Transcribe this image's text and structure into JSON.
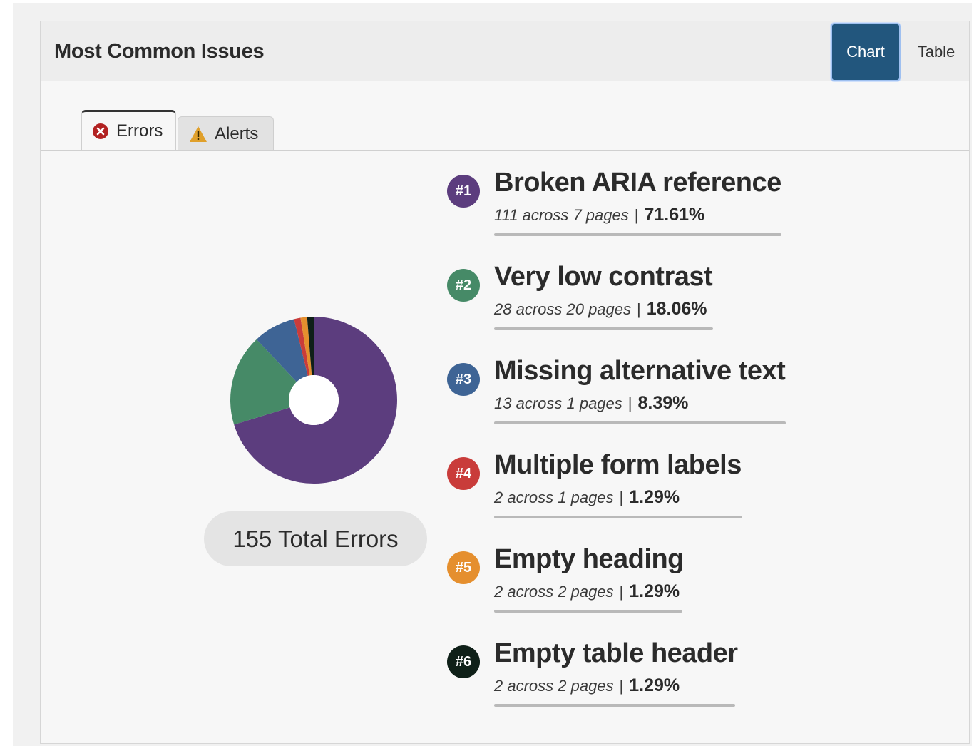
{
  "header": {
    "title": "Most Common Issues",
    "chart_button": "Chart",
    "table_button": "Table"
  },
  "tabs": [
    {
      "label": "Errors",
      "icon": "error-circle-icon",
      "active": true
    },
    {
      "label": "Alerts",
      "icon": "warning-triangle-icon",
      "active": false
    }
  ],
  "total_label": "155 Total Errors",
  "issues": [
    {
      "rank": "#1",
      "name": "Broken ARIA reference",
      "count_text": "111 across 7 pages",
      "percent": "71.61%",
      "color": "#5c3d7e"
    },
    {
      "rank": "#2",
      "name": "Very low contrast",
      "count_text": "28 across 20 pages",
      "percent": "18.06%",
      "color": "#468a67"
    },
    {
      "rank": "#3",
      "name": "Missing alternative text",
      "count_text": "13 across 1 pages",
      "percent": "8.39%",
      "color": "#3e6495"
    },
    {
      "rank": "#4",
      "name": "Multiple form labels",
      "count_text": "2 across 1 pages",
      "percent": "1.29%",
      "color": "#c93c3a"
    },
    {
      "rank": "#5",
      "name": "Empty heading",
      "count_text": "2 across 2 pages",
      "percent": "1.29%",
      "color": "#e58f2e"
    },
    {
      "rank": "#6",
      "name": "Empty table header",
      "count_text": "2 across 2 pages",
      "percent": "1.29%",
      "color": "#0f2018"
    }
  ],
  "chart_data": {
    "type": "pie",
    "categories": [
      "Broken ARIA reference",
      "Very low contrast",
      "Missing alternative text",
      "Multiple form labels",
      "Empty heading",
      "Empty table header"
    ],
    "values": [
      111,
      28,
      13,
      2,
      2,
      2
    ],
    "colors": [
      "#5c3d7e",
      "#468a67",
      "#3e6495",
      "#c93c3a",
      "#e58f2e",
      "#0f2018"
    ],
    "total": 155,
    "donut": true
  }
}
